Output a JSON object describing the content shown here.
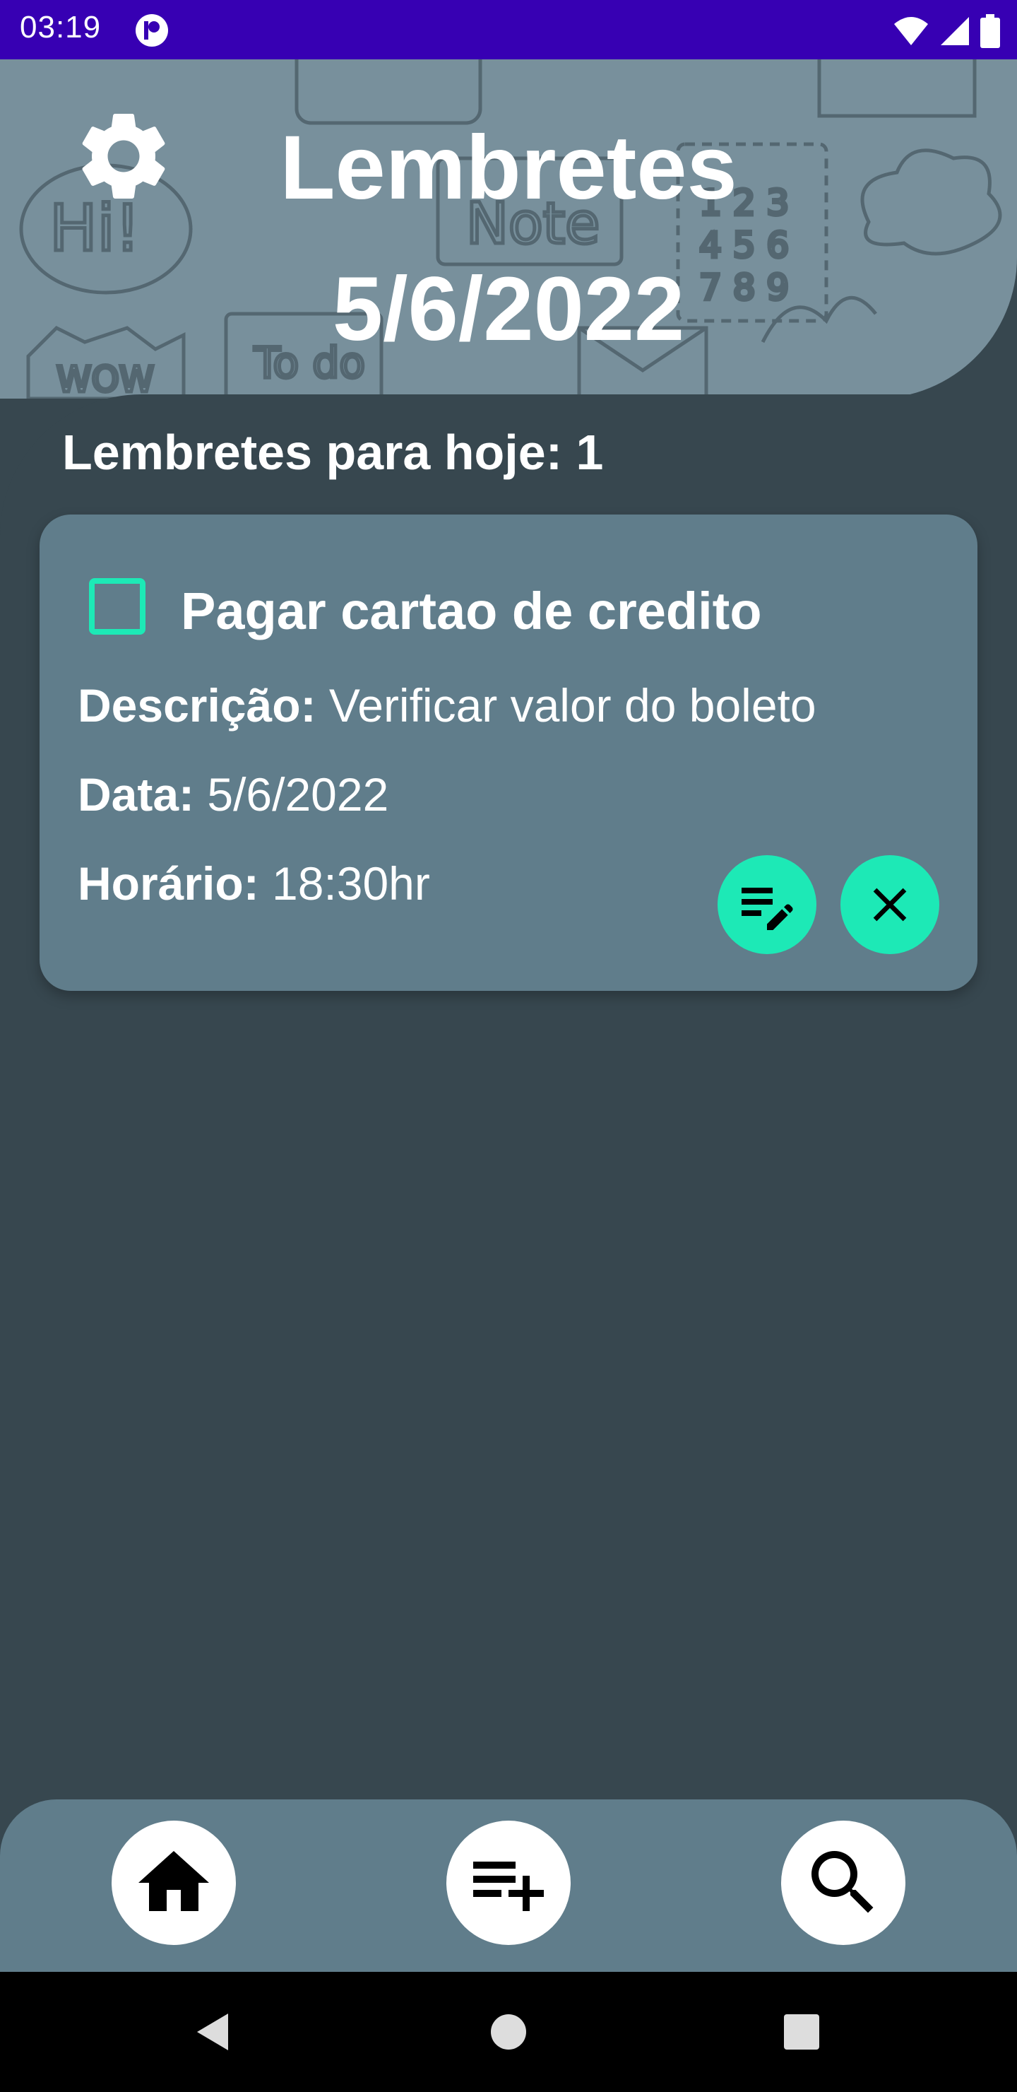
{
  "status_bar": {
    "time": "03:19",
    "icons": [
      "app-notification-icon",
      "wifi-icon",
      "signal-icon",
      "battery-icon"
    ]
  },
  "header": {
    "title": "Lembretes",
    "date": "5/6/2022",
    "settings_icon": "gear-icon",
    "background_color": "#78909c"
  },
  "today": {
    "label": "Lembretes para hoje: 1"
  },
  "reminder": {
    "title": "Pagar cartao de credito",
    "checked": false,
    "description_label": "Descrição:",
    "description_value": " Verificar valor do boleto",
    "date_label": "Data:",
    "date_value": " 5/6/2022",
    "time_label": "Horário:",
    "time_value": " 18:30hr",
    "edit_icon": "edit-note-icon",
    "delete_icon": "close-icon"
  },
  "bottom_nav": {
    "items": [
      {
        "icon": "home-icon"
      },
      {
        "icon": "playlist-add-icon"
      },
      {
        "icon": "search-icon"
      }
    ]
  },
  "system_nav": {
    "items": [
      "back-icon",
      "home-circle-icon",
      "recents-icon"
    ]
  },
  "colors": {
    "accent": "#1de9b6",
    "status_bar": "#3700b3",
    "background": "#37474f",
    "card": "#607d8b"
  }
}
